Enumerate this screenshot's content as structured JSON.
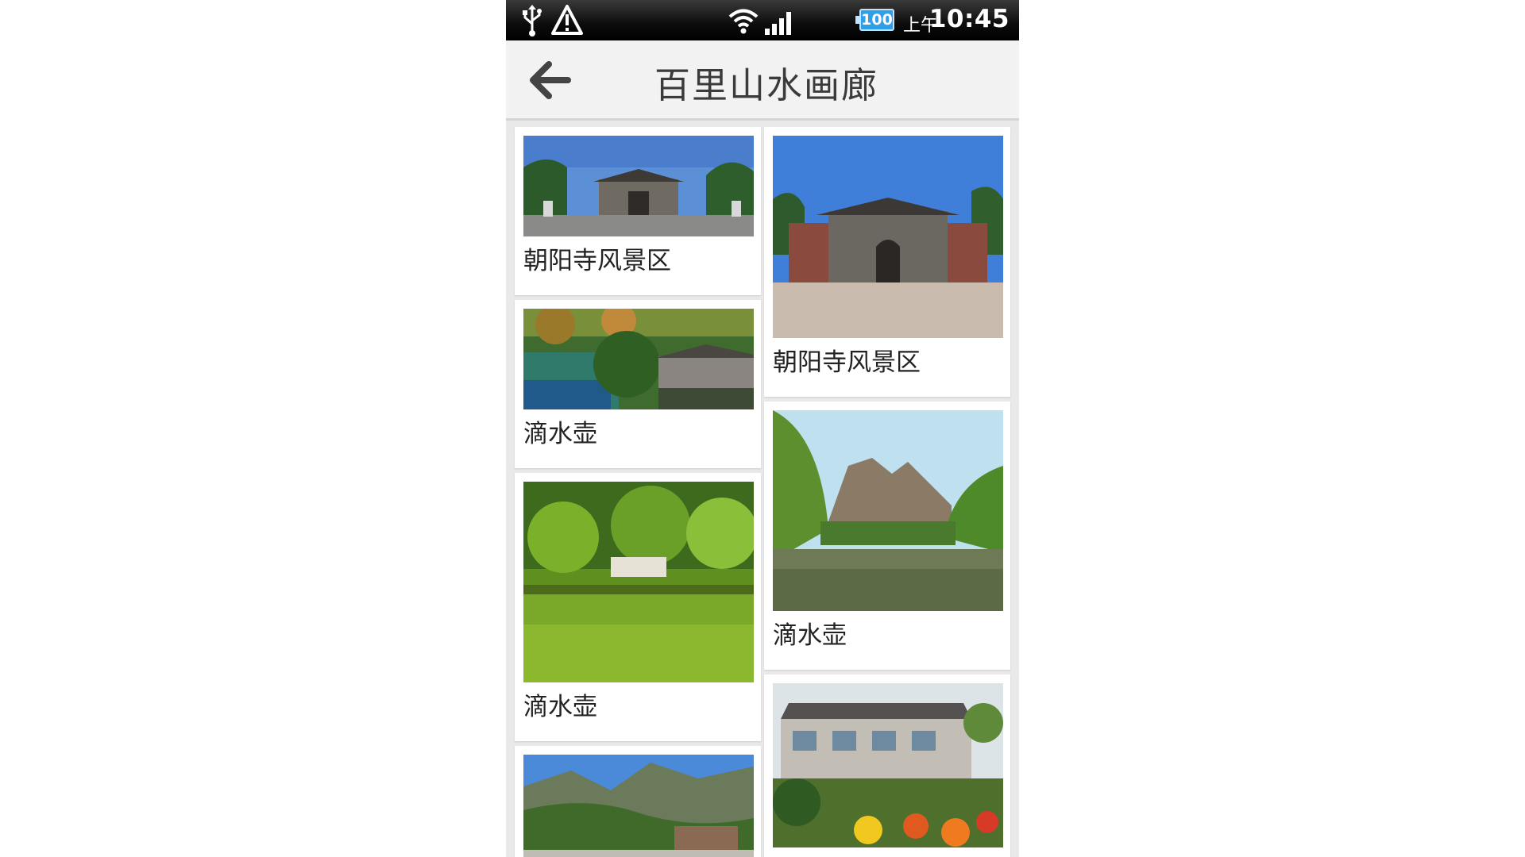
{
  "status_bar": {
    "icons": [
      "usb-icon",
      "warning-icon",
      "wifi-icon",
      "signal-icon",
      "battery-icon"
    ],
    "battery": "100",
    "ampm": "上午",
    "time": "10:45"
  },
  "header": {
    "back_icon": "arrow-left-icon",
    "title": "百里山水画廊"
  },
  "grid": {
    "left_column": [
      {
        "label": "朝阳寺风景区",
        "image": "temple-gate-wide-photo"
      },
      {
        "label": "滴水壶",
        "image": "lake-village-photo"
      },
      {
        "label": "滴水壶",
        "image": "willow-lake-photo"
      },
      {
        "label": "",
        "image": "mountain-village-photo"
      }
    ],
    "right_column": [
      {
        "label": "朝阳寺风景区",
        "image": "temple-gate-photo"
      },
      {
        "label": "滴水壶",
        "image": "mountain-river-photo"
      },
      {
        "label": "",
        "image": "farmhouse-garden-photo"
      }
    ]
  },
  "colors": {
    "status_bar": "#000000",
    "header_bg": "#f2f2f2",
    "grid_bg": "#e9e9e9",
    "card_bg": "#ffffff",
    "battery": "#2f9fe6"
  }
}
